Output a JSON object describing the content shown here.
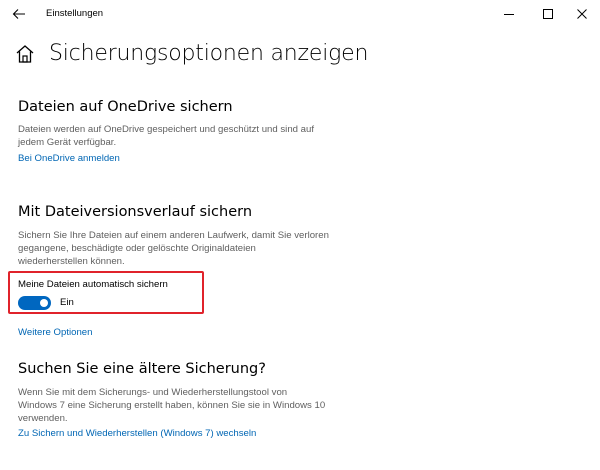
{
  "window": {
    "title": "Einstellungen",
    "back_icon": "arrow-left-icon",
    "minimize_icon": "minimize-icon",
    "maximize_icon": "maximize-icon",
    "close_icon": "close-icon"
  },
  "header": {
    "home_icon": "home-icon",
    "title": "Sicherungsoptionen anzeigen"
  },
  "onedrive": {
    "heading": "Dateien auf OneDrive sichern",
    "description_line1": "Dateien werden auf OneDrive gespeichert und geschützt und sind auf",
    "description_line2": "jedem Gerät verfügbar.",
    "link": "Bei OneDrive anmelden"
  },
  "file_history": {
    "heading": "Mit Dateiversionsverlauf sichern",
    "description_line1": "Sichern Sie Ihre Dateien auf einem anderen Laufwerk, damit Sie verloren",
    "description_line2": "gegangene, beschädigte oder gelöschte Originaldateien",
    "description_line3": "wiederherstellen können.",
    "toggle_label": "Meine Dateien automatisch sichern",
    "toggle_on": true,
    "toggle_state": "Ein",
    "more_options_link": "Weitere Optionen"
  },
  "older_backup": {
    "heading": "Suchen Sie eine ältere Sicherung?",
    "description_line1": "Wenn Sie mit dem Sicherungs- und Wiederherstellungstool von",
    "description_line2": "Windows 7 eine Sicherung erstellt haben, können Sie sie in Windows 10",
    "description_line3": "verwenden.",
    "link": "Zu Sichern und Wiederherstellen (Windows 7) wechseln"
  },
  "colors": {
    "accent": "#0067c0",
    "link": "#0066b4",
    "highlight_border": "#e0232b",
    "secondary_text": "#5f5f5f"
  }
}
